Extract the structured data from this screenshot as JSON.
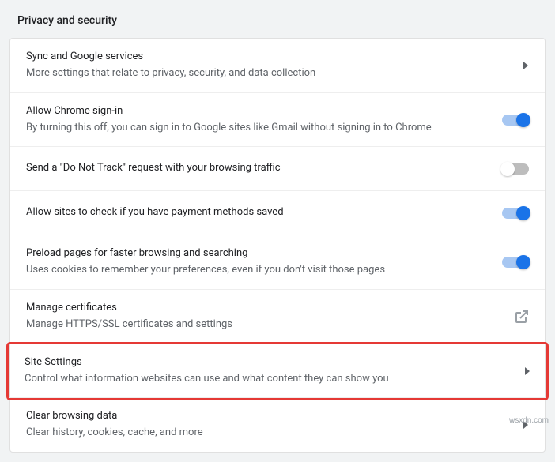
{
  "section_title": "Privacy and security",
  "rows": [
    {
      "title": "Sync and Google services",
      "sub": "More settings that relate to privacy, security, and data collection",
      "control": "chevron"
    },
    {
      "title": "Allow Chrome sign-in",
      "sub": "By turning this off, you can sign in to Google sites like Gmail without signing in to Chrome",
      "control": "toggle",
      "toggle_on": true
    },
    {
      "title": "Send a \"Do Not Track\" request with your browsing traffic",
      "sub": "",
      "control": "toggle",
      "toggle_on": false
    },
    {
      "title": "Allow sites to check if you have payment methods saved",
      "sub": "",
      "control": "toggle",
      "toggle_on": true
    },
    {
      "title": "Preload pages for faster browsing and searching",
      "sub": "Uses cookies to remember your preferences, even if you don't visit those pages",
      "control": "toggle",
      "toggle_on": true
    },
    {
      "title": "Manage certificates",
      "sub": "Manage HTTPS/SSL certificates and settings",
      "control": "external"
    },
    {
      "title": "Site Settings",
      "sub": "Control what information websites can use and what content they can show you",
      "control": "chevron",
      "highlighted": true
    },
    {
      "title": "Clear browsing data",
      "sub": "Clear history, cookies, cache, and more",
      "control": "chevron"
    }
  ],
  "watermark": "wsxdn.com"
}
